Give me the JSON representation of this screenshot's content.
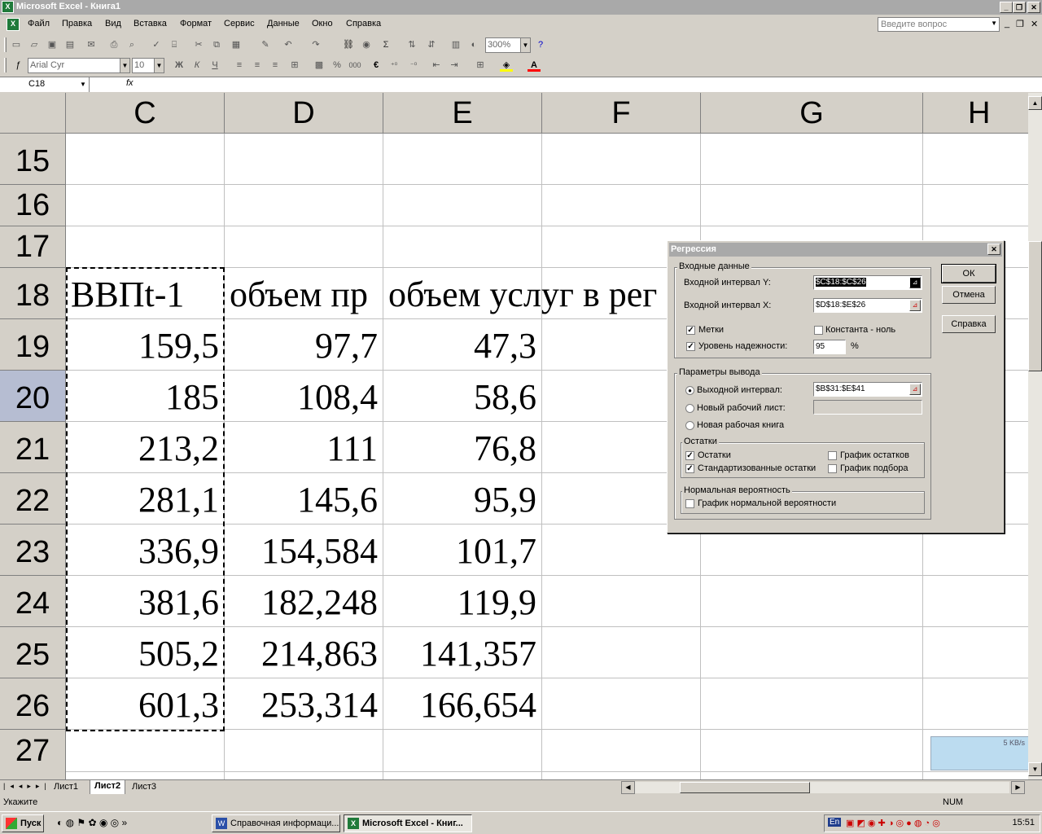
{
  "window": {
    "title": "Microsoft Excel - Книга1"
  },
  "menu": [
    "Файл",
    "Правка",
    "Вид",
    "Вставка",
    "Формат",
    "Сервис",
    "Данные",
    "Окно",
    "Справка"
  ],
  "help_box": {
    "placeholder": "Введите вопрос"
  },
  "toolbar": {
    "zoom": "300%",
    "font": "Arial Cyr",
    "size": "10",
    "bold": "Ж",
    "italic": "К",
    "underline": "Ч",
    "percent": "%",
    "thousands": "000",
    "euro": "€"
  },
  "formula_bar": {
    "cell_ref": "C18",
    "fx": "fx"
  },
  "columns": [
    "C",
    "D",
    "E",
    "F",
    "G",
    "H"
  ],
  "rows": [
    "15",
    "16",
    "17",
    "18",
    "19",
    "20",
    "21",
    "22",
    "23",
    "24",
    "25",
    "26",
    "27"
  ],
  "headers": {
    "c18": "ВВПt-1",
    "d18": "объем пр",
    "e18": "объем услуг в рег"
  },
  "table": [
    [
      "159,5",
      "97,7",
      "47,3"
    ],
    [
      "185",
      "108,4",
      "58,6"
    ],
    [
      "213,2",
      "111",
      "76,8"
    ],
    [
      "281,1",
      "145,6",
      "95,9"
    ],
    [
      "336,9",
      "154,584",
      "101,7"
    ],
    [
      "381,6",
      "182,248",
      "119,9"
    ],
    [
      "505,2",
      "214,863",
      "141,357"
    ],
    [
      "601,3",
      "253,314",
      "166,654"
    ]
  ],
  "sheets": [
    "Лист1",
    "Лист2",
    "Лист3"
  ],
  "status": {
    "left": "Укажите",
    "num": "NUM"
  },
  "dialog": {
    "title": "Регрессия",
    "input_group": "Входные данные",
    "y_label": "Входной интервал Y:",
    "y_value": "$C$18:$C$26",
    "x_label": "Входной интервал X:",
    "x_value": "$D$18:$E$26",
    "labels_cb": "Метки",
    "const_cb": "Константа - ноль",
    "conf_cb": "Уровень надежности:",
    "conf_value": "95",
    "pct": "%",
    "output_group": "Параметры вывода",
    "out_range": "Выходной интервал:",
    "out_value": "$B$31:$E$41",
    "new_sheet": "Новый рабочий лист:",
    "new_book": "Новая рабочая книга",
    "resid_group": "Остатки",
    "resid": "Остатки",
    "std_resid": "Стандартизованные остатки",
    "resid_plot": "График остатков",
    "fit_plot": "График подбора",
    "normal_group": "Нормальная вероятность",
    "normal_plot": "График нормальной вероятности",
    "ok": "ОК",
    "cancel": "Отмена",
    "help": "Справка"
  },
  "taskbar": {
    "start": "Пуск",
    "task1": "Справочная информаци...",
    "task2": "Microsoft Excel - Книг...",
    "lang": "En",
    "clock": "15:51"
  },
  "widget": {
    "speed": "5 KB/s"
  }
}
